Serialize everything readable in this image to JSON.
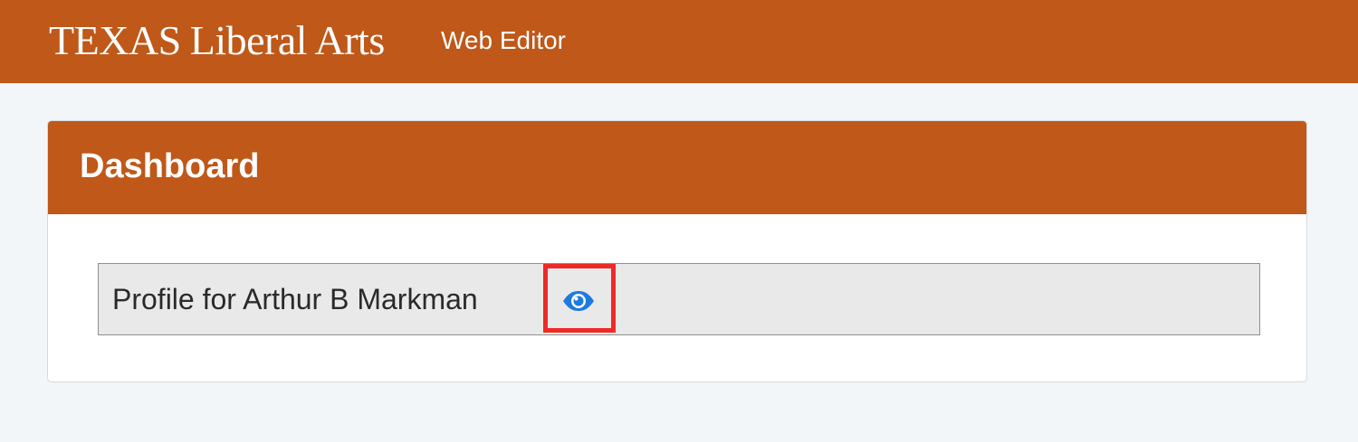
{
  "header": {
    "brand_first": "TEXAS",
    "brand_rest": "Liberal Arts",
    "app_name": "Web Editor",
    "background_color": "#bf5818"
  },
  "dashboard": {
    "title": "Dashboard",
    "profile_label": "Profile for Arthur B Markman",
    "view_icon": "eye-icon",
    "view_icon_color": "#1f7ae0",
    "highlight_color": "#ee2a26"
  }
}
